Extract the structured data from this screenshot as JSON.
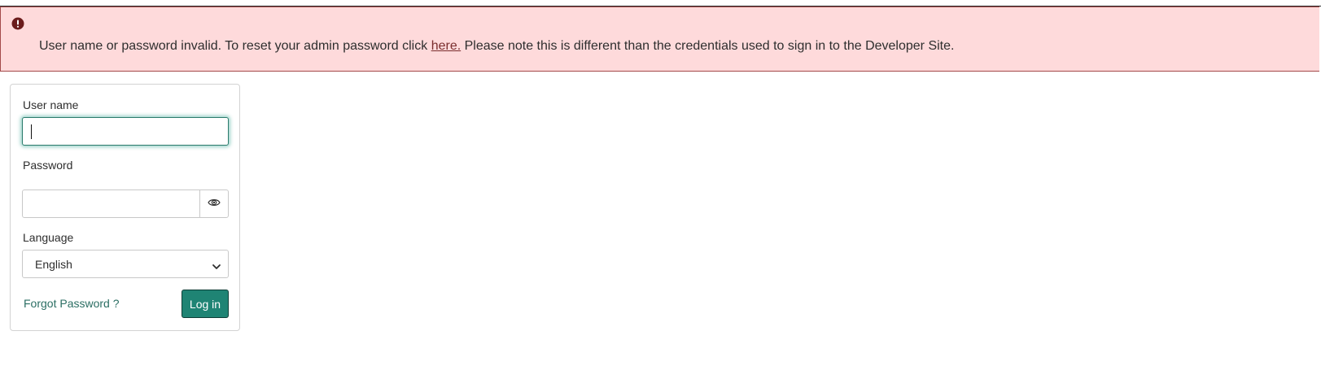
{
  "alert": {
    "icon": "exclamation-circle-icon",
    "message_before_link": "User name or password invalid. To reset your admin password click ",
    "link_text": "here.",
    "message_after_link": " Please note this is different than the credentials used to sign in to the Developer Site.",
    "background_color": "#fedadb",
    "icon_color": "#6b1b1b"
  },
  "login_form": {
    "username_label": "User name",
    "username_value": "",
    "password_label": "Password",
    "password_value": "",
    "show_password_icon": "eye-icon",
    "language_label": "Language",
    "language_selected": "English",
    "forgot_password_label": "Forgot Password ?",
    "login_button_label": "Log in",
    "accent_color": "#1f8474"
  }
}
